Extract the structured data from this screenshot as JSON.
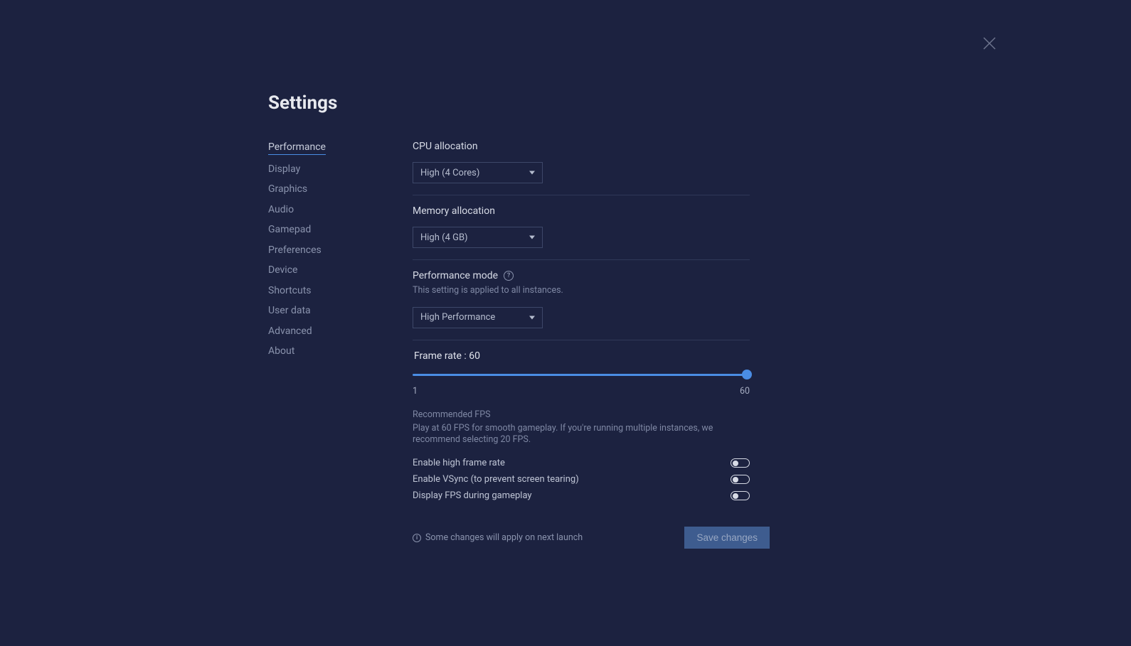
{
  "title": "Settings",
  "sidebar": {
    "items": [
      "Performance",
      "Display",
      "Graphics",
      "Audio",
      "Gamepad",
      "Preferences",
      "Device",
      "Shortcuts",
      "User data",
      "Advanced",
      "About"
    ]
  },
  "cpu": {
    "label": "CPU allocation",
    "value": "High (4 Cores)"
  },
  "memory": {
    "label": "Memory allocation",
    "value": "High (4 GB)"
  },
  "perfmode": {
    "label": "Performance mode",
    "sublabel": "This setting is applied to all instances.",
    "value": "High Performance"
  },
  "frame": {
    "label": "Frame rate : 60",
    "min": "1",
    "max": "60",
    "rec_title": "Recommended FPS",
    "rec_text": "Play at 60 FPS for smooth gameplay. If you're running multiple instances, we recommend selecting 20 FPS."
  },
  "toggles": {
    "highframe": "Enable high frame rate",
    "vsync": "Enable VSync (to prevent screen tearing)",
    "fps": "Display FPS during gameplay"
  },
  "footer": {
    "note": "Some changes will apply on next launch",
    "save": "Save changes"
  }
}
